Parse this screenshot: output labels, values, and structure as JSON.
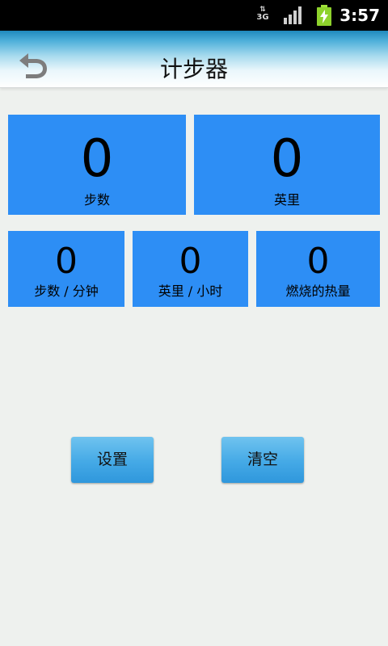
{
  "status_bar": {
    "network": "3G",
    "time": "3:57",
    "icons": [
      "network-3g-icon",
      "signal-icon",
      "battery-charging-icon"
    ]
  },
  "header": {
    "title": "计步器",
    "back_icon": "back-arrow-icon"
  },
  "stats_primary": [
    {
      "value": "0",
      "label": "步数"
    },
    {
      "value": "0",
      "label": "英里"
    }
  ],
  "stats_secondary": [
    {
      "value": "0",
      "label": "步数 / 分钟"
    },
    {
      "value": "0",
      "label": "英里 / 小时"
    },
    {
      "value": "0",
      "label": "燃烧的热量"
    }
  ],
  "actions": {
    "settings_label": "设置",
    "clear_label": "清空"
  },
  "colors": {
    "tile": "#2d8ef5",
    "button": "#44a9e6",
    "background": "#eef1ee"
  }
}
